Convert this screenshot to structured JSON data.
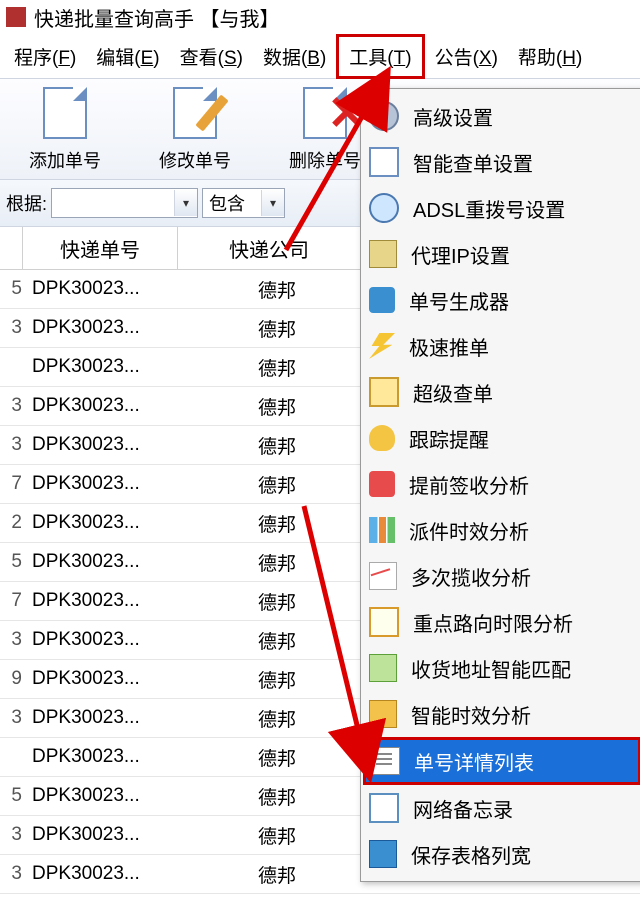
{
  "titlebar": {
    "title": "快递批量查询高手 【与我】"
  },
  "menubar": {
    "items": [
      {
        "label": "程序",
        "key": "F"
      },
      {
        "label": "编辑",
        "key": "E"
      },
      {
        "label": "查看",
        "key": "S"
      },
      {
        "label": "数据",
        "key": "B"
      },
      {
        "label": "工具",
        "key": "T"
      },
      {
        "label": "公告",
        "key": "X"
      },
      {
        "label": "帮助",
        "key": "H"
      }
    ]
  },
  "toolbar": {
    "add": "添加单号",
    "edit": "修改单号",
    "delete": "删除单号"
  },
  "filterbar": {
    "by": "根据:",
    "value": "",
    "op": "包含"
  },
  "grid": {
    "col0": "",
    "col1": "快递单号",
    "col2": "快递公司",
    "rows": [
      {
        "i": "5",
        "no": "DPK30023...",
        "co": "德邦"
      },
      {
        "i": "3",
        "no": "DPK30023...",
        "co": "德邦"
      },
      {
        "i": "",
        "no": "DPK30023...",
        "co": "德邦"
      },
      {
        "i": "3",
        "no": "DPK30023...",
        "co": "德邦"
      },
      {
        "i": "3",
        "no": "DPK30023...",
        "co": "德邦"
      },
      {
        "i": "7",
        "no": "DPK30023...",
        "co": "德邦"
      },
      {
        "i": "2",
        "no": "DPK30023...",
        "co": "德邦"
      },
      {
        "i": "5",
        "no": "DPK30023...",
        "co": "德邦"
      },
      {
        "i": "7",
        "no": "DPK30023...",
        "co": "德邦"
      },
      {
        "i": "3",
        "no": "DPK30023...",
        "co": "德邦"
      },
      {
        "i": "9",
        "no": "DPK30023...",
        "co": "德邦"
      },
      {
        "i": "3",
        "no": "DPK30023...",
        "co": "德邦"
      },
      {
        "i": "",
        "no": "DPK30023...",
        "co": "德邦"
      },
      {
        "i": "5",
        "no": "DPK30023...",
        "co": "德邦"
      },
      {
        "i": "3",
        "no": "DPK30023...",
        "co": "德邦"
      },
      {
        "i": "3",
        "no": "DPK30023...",
        "co": "德邦"
      }
    ]
  },
  "tools_menu": {
    "items": [
      {
        "label": "高级设置",
        "icon": "gear"
      },
      {
        "label": "智能查单设置",
        "icon": "doc2"
      },
      {
        "label": "ADSL重拨号设置",
        "icon": "net"
      },
      {
        "label": "代理IP设置",
        "icon": "key"
      },
      {
        "label": "单号生成器",
        "icon": "car"
      },
      {
        "label": "极速推单",
        "icon": "bolt"
      },
      {
        "label": "超级查单",
        "icon": "table"
      },
      {
        "label": "跟踪提醒",
        "icon": "bell"
      },
      {
        "label": "提前签收分析",
        "icon": "chart"
      },
      {
        "label": "派件时效分析",
        "icon": "bars"
      },
      {
        "label": "多次揽收分析",
        "icon": "line"
      },
      {
        "label": "重点路向时限分析",
        "icon": "magnify"
      },
      {
        "label": "收货地址智能匹配",
        "icon": "ruler"
      },
      {
        "label": "智能时效分析",
        "icon": "pen"
      },
      {
        "label": "单号详情列表",
        "icon": "list",
        "selected": true
      },
      {
        "label": "网络备忘录",
        "icon": "note"
      },
      {
        "label": "保存表格列宽",
        "icon": "save"
      }
    ]
  }
}
